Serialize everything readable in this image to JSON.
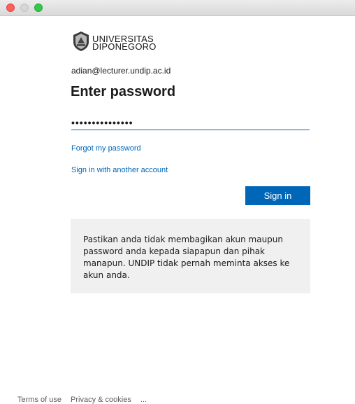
{
  "window": {
    "traffic_lights": [
      "close",
      "minimize",
      "maximize"
    ]
  },
  "logo": {
    "line1": "UNIVERSITAS",
    "line2": "DIPONEGORO",
    "emblem_icon": "undip-emblem-icon"
  },
  "account": {
    "email": "adian@lecturer.undip.ac.id"
  },
  "form": {
    "heading": "Enter password",
    "password_value": "•••••••••••••••",
    "forgot_link": "Forgot my password",
    "other_account_link": "Sign in with another account",
    "signin_label": "Sign in"
  },
  "notice": {
    "text": "Pastikan anda tidak membagikan akun maupun password anda kepada siapapun dan pihak manapun. UNDIP tidak pernah meminta akses ke akun anda."
  },
  "footer": {
    "terms": "Terms of use",
    "privacy": "Privacy & cookies",
    "more": "..."
  },
  "colors": {
    "accent": "#0067b8",
    "notice_bg": "#f0f0f0"
  }
}
